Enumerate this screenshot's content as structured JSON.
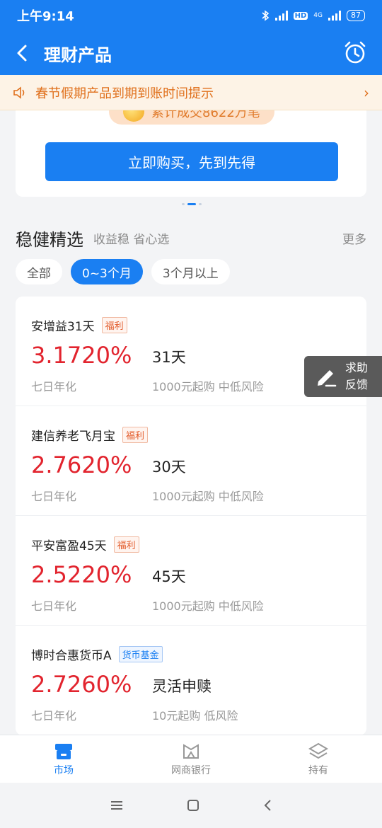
{
  "status": {
    "time": "上午9:14",
    "hd": "HD",
    "net": "4G",
    "battery": "87"
  },
  "nav": {
    "title": "理财产品"
  },
  "notice": {
    "text": "春节假期产品到期到账时间提示"
  },
  "promo": {
    "cumulative_text": "累计成交8622万笔",
    "buy_label": "立即购买，先到先得"
  },
  "section": {
    "title": "稳健精选",
    "subtitle": "收益稳 省心选",
    "more": "更多"
  },
  "filters": [
    {
      "label": "全部",
      "active": false
    },
    {
      "label": "0~3个月",
      "active": true
    },
    {
      "label": "3个月以上",
      "active": false
    }
  ],
  "products": [
    {
      "name": "安增益31天",
      "tag": "福利",
      "rate": "3.1720%",
      "rate_label": "七日年化",
      "term": "31天",
      "min": "1000元起购 中低风险"
    },
    {
      "name": "建信养老飞月宝",
      "tag": "福利",
      "rate": "2.7620%",
      "rate_label": "七日年化",
      "term": "30天",
      "min": "1000元起购 中低风险"
    },
    {
      "name": "平安富盈45天",
      "tag": "福利",
      "rate": "2.5220%",
      "rate_label": "七日年化",
      "term": "45天",
      "min": "1000元起购 中低风险"
    },
    {
      "name": "博时合惠货币A",
      "tag": "货币基金",
      "rate": "2.7260%",
      "rate_label": "七日年化",
      "term": "灵活申赎",
      "min": "10元起购 低风险"
    }
  ],
  "feedback": {
    "line1": "求助",
    "line2": "反馈"
  },
  "tabbar": [
    {
      "label": "市场",
      "icon": "store-icon",
      "active": true
    },
    {
      "label": "网商银行",
      "icon": "bank-logo-icon",
      "active": false
    },
    {
      "label": "持有",
      "icon": "layers-icon",
      "active": false
    }
  ],
  "colors": {
    "primary": "#1a7ff2",
    "rate": "#e2242e",
    "notice": "#e0701c"
  }
}
